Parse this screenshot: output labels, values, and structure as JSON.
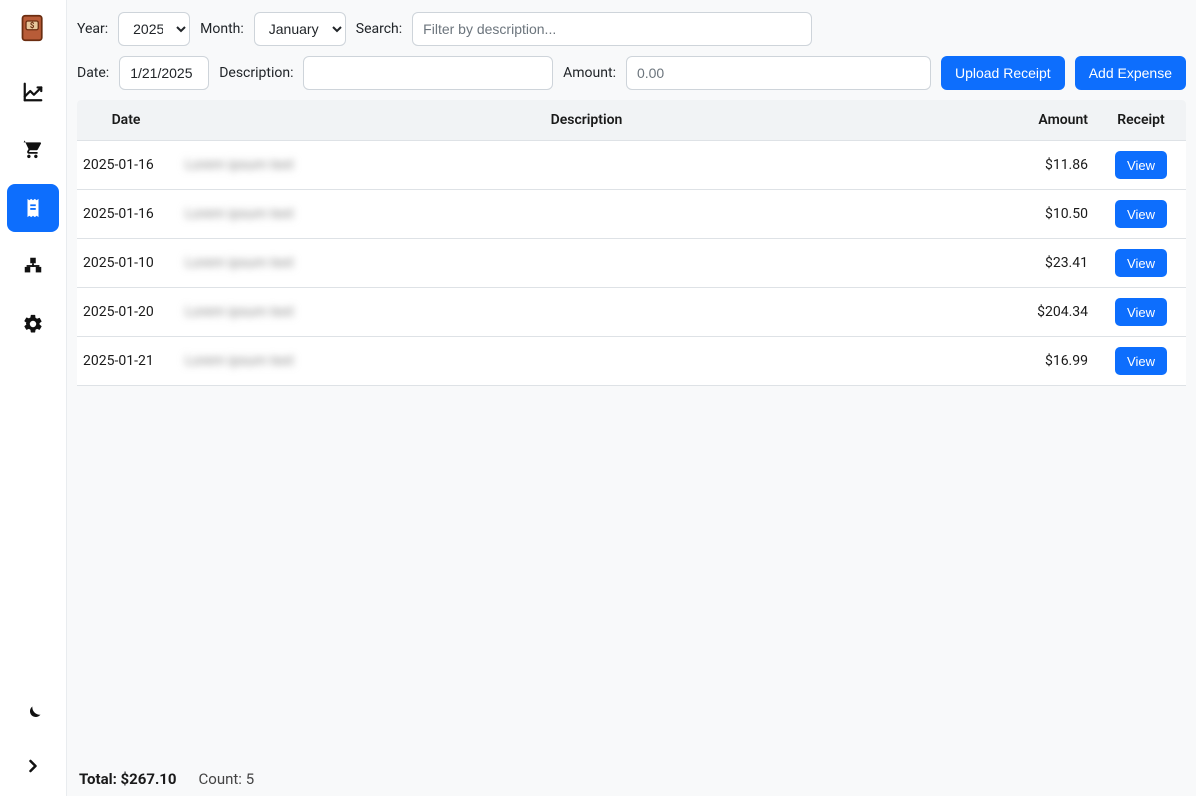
{
  "sidebar": {
    "items": [
      {
        "name": "dashboard",
        "icon": "chart"
      },
      {
        "name": "shopping",
        "icon": "cart"
      },
      {
        "name": "receipts",
        "icon": "receipt",
        "active": true
      },
      {
        "name": "categories",
        "icon": "boxes"
      },
      {
        "name": "settings",
        "icon": "gear"
      }
    ]
  },
  "filters": {
    "year_label": "Year:",
    "year_value": "2025",
    "month_label": "Month:",
    "month_value": "January",
    "search_label": "Search:",
    "search_placeholder": "Filter by description..."
  },
  "form": {
    "date_label": "Date:",
    "date_value": "1/21/2025",
    "description_label": "Description:",
    "description_value": "",
    "amount_label": "Amount:",
    "amount_placeholder": "0.00",
    "upload_label": "Upload Receipt",
    "add_label": "Add Expense"
  },
  "table": {
    "headers": {
      "date": "Date",
      "description": "Description",
      "amount": "Amount",
      "receipt": "Receipt"
    },
    "view_label": "View",
    "rows": [
      {
        "date": "2025-01-16",
        "description": "—",
        "amount": "$11.86"
      },
      {
        "date": "2025-01-16",
        "description": "—",
        "amount": "$10.50"
      },
      {
        "date": "2025-01-10",
        "description": "—",
        "amount": "$23.41"
      },
      {
        "date": "2025-01-20",
        "description": "—",
        "amount": "$204.34"
      },
      {
        "date": "2025-01-21",
        "description": "—",
        "amount": "$16.99"
      }
    ]
  },
  "footer": {
    "total_label": "Total:",
    "total_value": "$267.10",
    "count_label": "Count:",
    "count_value": "5"
  }
}
